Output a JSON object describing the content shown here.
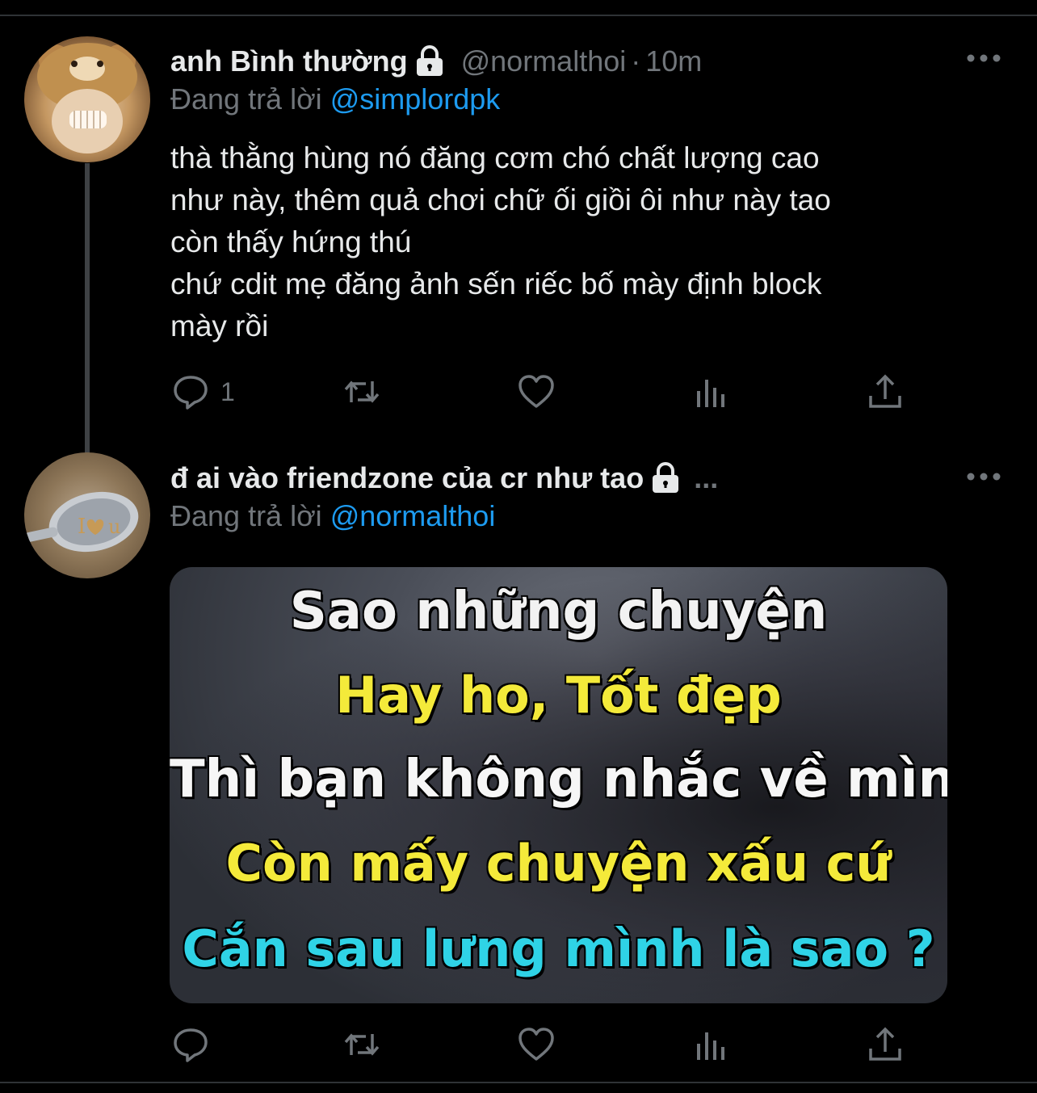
{
  "colors": {
    "background": "#000000",
    "text": "#e7e9ea",
    "muted": "#71767b",
    "accent": "#1d9bf0",
    "divider": "#2f3336"
  },
  "tweets": [
    {
      "display_name": "anh Bình thường",
      "protected_icon": "lock-icon",
      "handle": "@normalthoi",
      "separator": "·",
      "time": "10m",
      "reply_prefix": "Đang trả lời",
      "reply_to": "@simplordpk",
      "text_lines": [
        "thà thằng hùng nó đăng cơm chó chất lượng cao",
        "như này, thêm quả chơi chữ ối giồi ôi như này tao",
        "còn thấy hứng thú",
        "chứ cdit mẹ đăng ảnh sến riếc bố mày định block",
        "mày rồi"
      ],
      "reply_count": "1",
      "avatar_icon": "bear-hat-avatar",
      "actions": [
        "reply-icon",
        "retweet-icon",
        "like-icon",
        "views-icon",
        "share-icon"
      ]
    },
    {
      "display_name": "đ ai vào friendzone của cr như tao",
      "protected_icon": "lock-icon",
      "truncation": "...",
      "reply_prefix": "Đang trả lời",
      "reply_to": "@normalthoi",
      "avatar_icon": "spoon-avatar",
      "media_caption": [
        "Sao những chuyện",
        "Hay ho, Tốt đẹp",
        "Thì bạn không nhắc về mình",
        "Còn mấy chuyện xấu cứ",
        "Cắn sau lưng mình là sao ?"
      ],
      "actions": [
        "reply-icon",
        "retweet-icon",
        "like-icon",
        "views-icon",
        "share-icon"
      ]
    }
  ]
}
